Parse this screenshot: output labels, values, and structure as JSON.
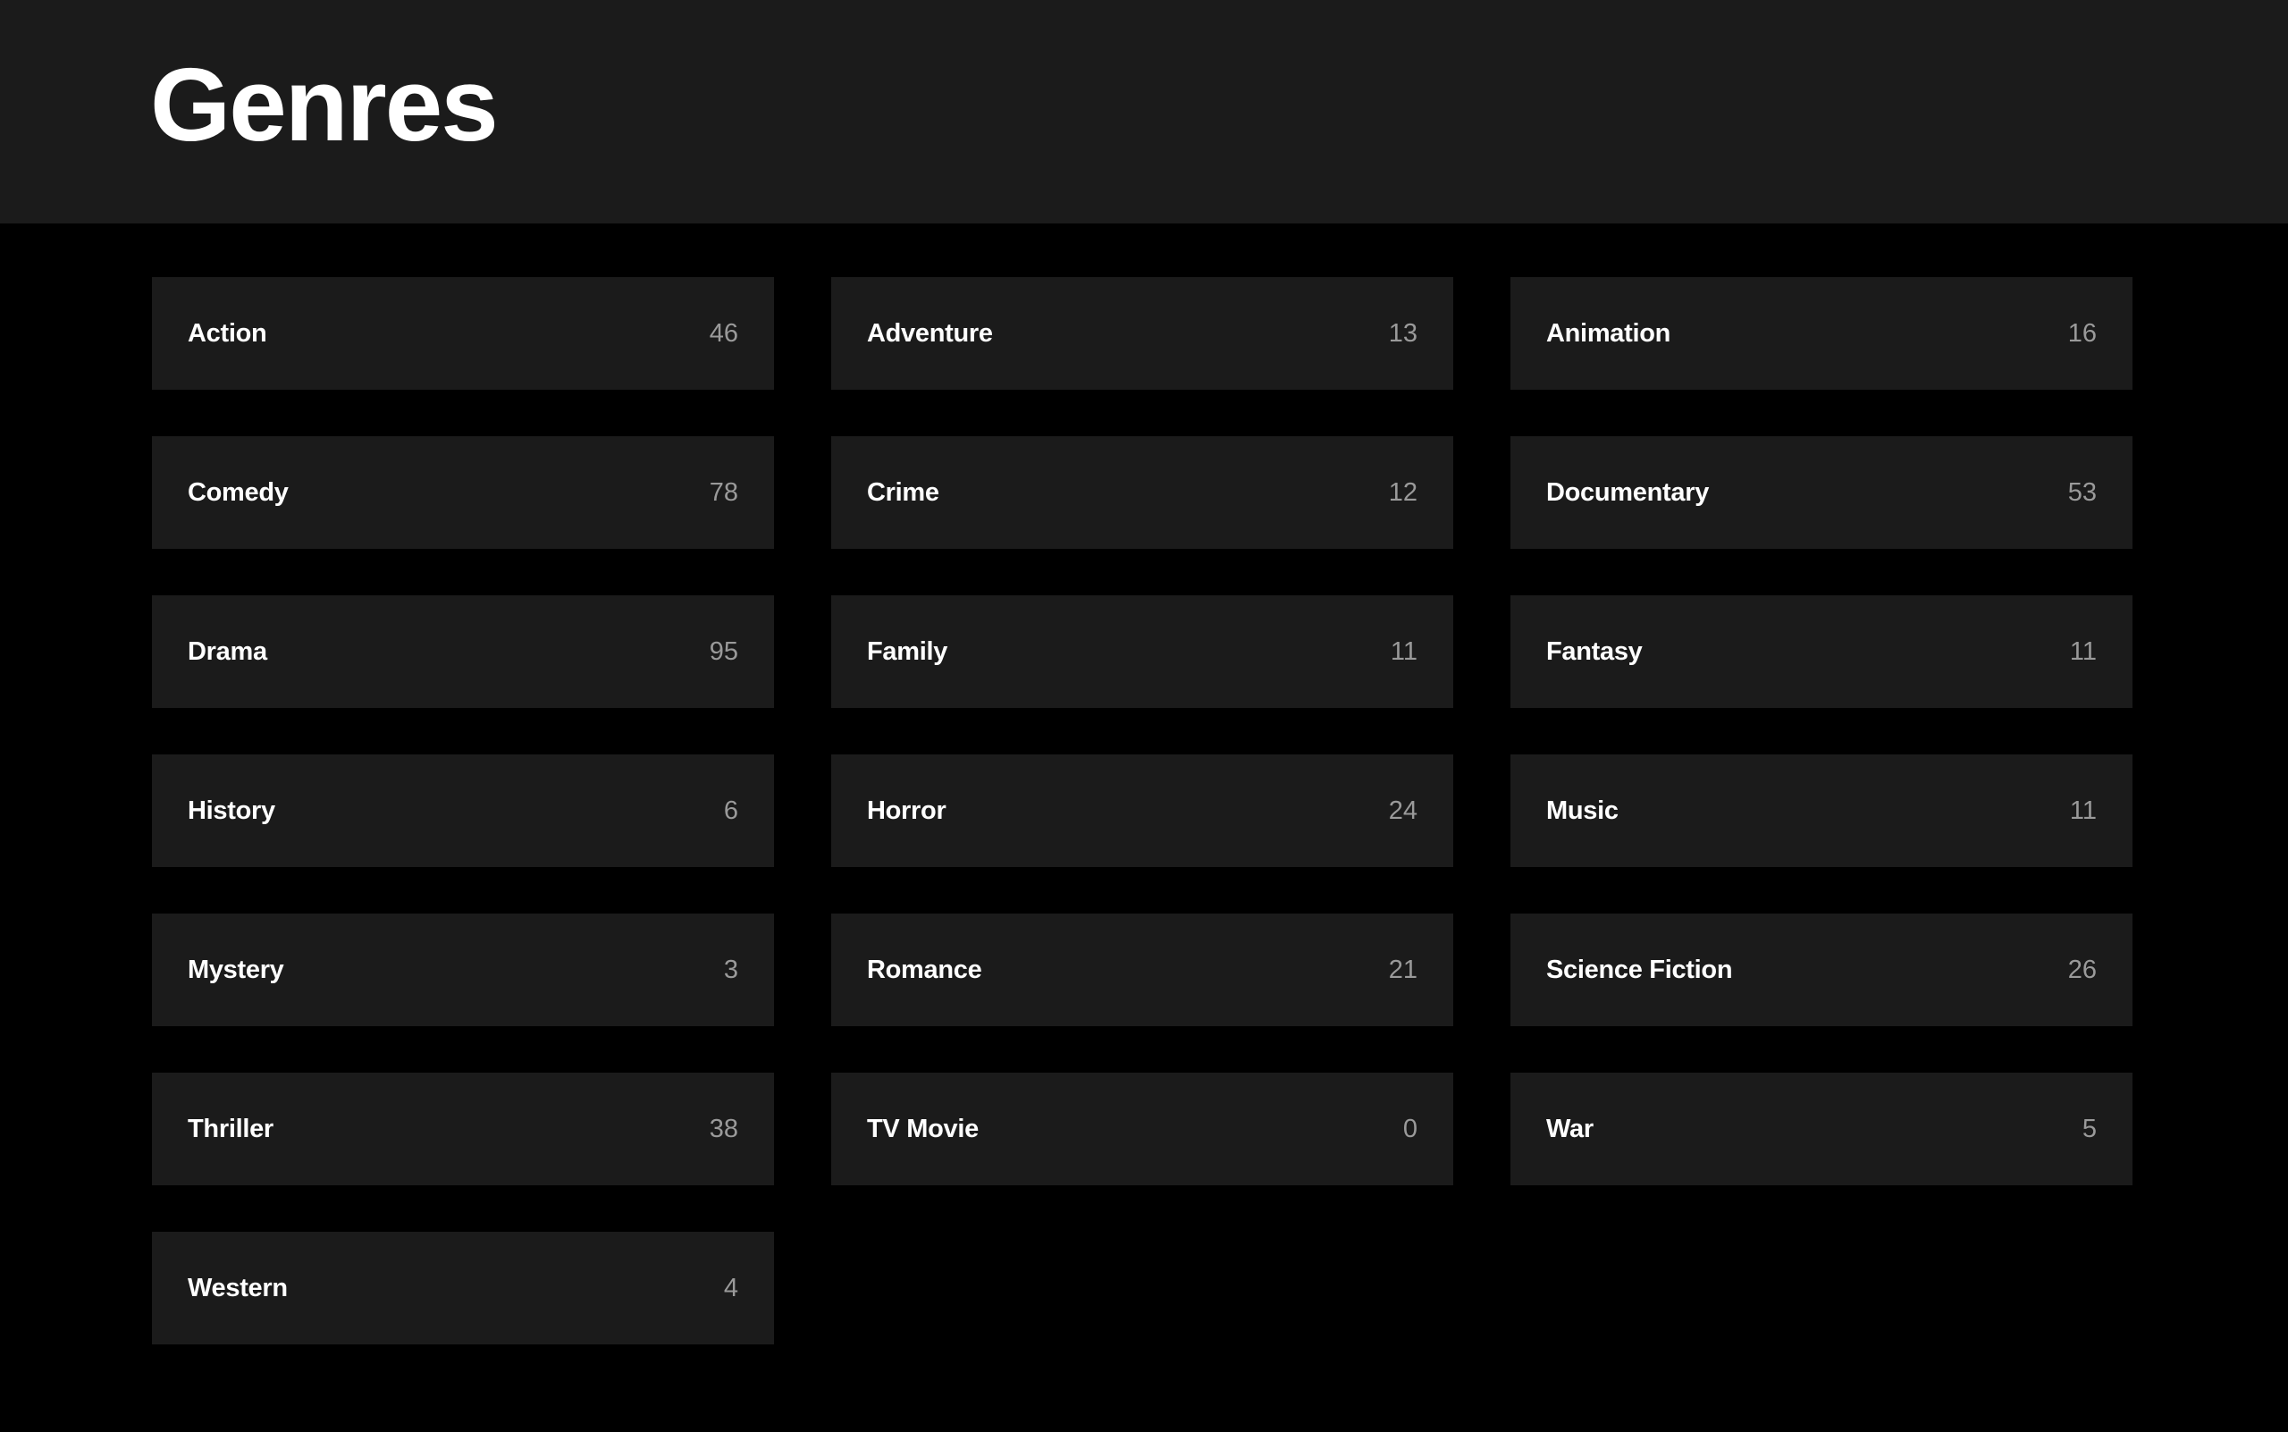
{
  "header": {
    "title": "Genres"
  },
  "colors": {
    "page_background": "#000000",
    "card_background": "#1b1b1b",
    "title_text": "#ffffff",
    "count_text": "#9a9a9a"
  },
  "genres": [
    {
      "name": "Action",
      "count": "46"
    },
    {
      "name": "Adventure",
      "count": "13"
    },
    {
      "name": "Animation",
      "count": "16"
    },
    {
      "name": "Comedy",
      "count": "78"
    },
    {
      "name": "Crime",
      "count": "12"
    },
    {
      "name": "Documentary",
      "count": "53"
    },
    {
      "name": "Drama",
      "count": "95"
    },
    {
      "name": "Family",
      "count": "11"
    },
    {
      "name": "Fantasy",
      "count": "11"
    },
    {
      "name": "History",
      "count": "6"
    },
    {
      "name": "Horror",
      "count": "24"
    },
    {
      "name": "Music",
      "count": "11"
    },
    {
      "name": "Mystery",
      "count": "3"
    },
    {
      "name": "Romance",
      "count": "21"
    },
    {
      "name": "Science Fiction",
      "count": "26"
    },
    {
      "name": "Thriller",
      "count": "38"
    },
    {
      "name": "TV Movie",
      "count": "0"
    },
    {
      "name": "War",
      "count": "5"
    },
    {
      "name": "Western",
      "count": "4"
    }
  ]
}
